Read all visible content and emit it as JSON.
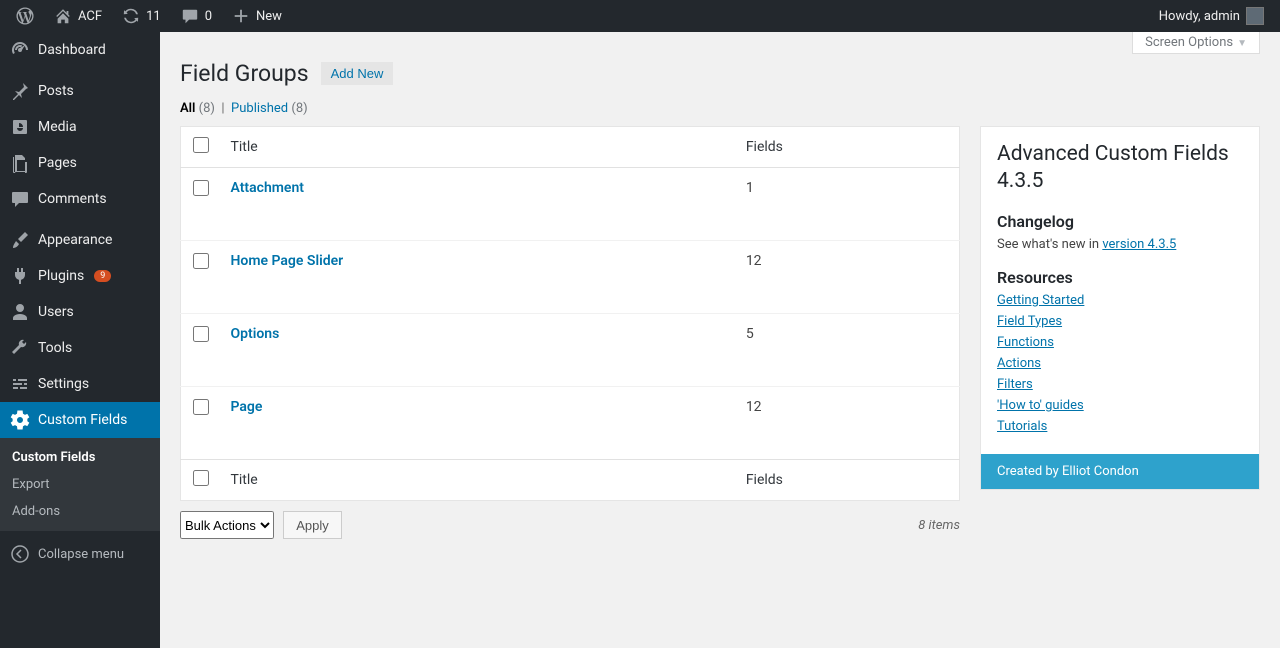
{
  "adminbar": {
    "site_name": "ACF",
    "updates_count": "11",
    "comments_count": "0",
    "new_label": "New",
    "howdy_prefix": "Howdy,",
    "user_name": "admin"
  },
  "sidebar": {
    "items": [
      {
        "label": "Dashboard",
        "icon": "dashboard"
      },
      {
        "label": "Posts",
        "icon": "pin"
      },
      {
        "label": "Media",
        "icon": "media"
      },
      {
        "label": "Pages",
        "icon": "pages"
      },
      {
        "label": "Comments",
        "icon": "comment"
      },
      {
        "label": "Appearance",
        "icon": "brush"
      },
      {
        "label": "Plugins",
        "icon": "plugin",
        "badge": "9"
      },
      {
        "label": "Users",
        "icon": "user"
      },
      {
        "label": "Tools",
        "icon": "wrench"
      },
      {
        "label": "Settings",
        "icon": "sliders"
      },
      {
        "label": "Custom Fields",
        "icon": "gear",
        "current": true
      }
    ],
    "submenu": [
      {
        "label": "Custom Fields",
        "current": true
      },
      {
        "label": "Export"
      },
      {
        "label": "Add-ons"
      }
    ],
    "collapse_label": "Collapse menu"
  },
  "screen_options_label": "Screen Options",
  "page": {
    "title": "Field Groups",
    "add_new_label": "Add New"
  },
  "filters": {
    "all_label": "All",
    "all_count": "(8)",
    "published_label": "Published",
    "published_count": "(8)"
  },
  "table": {
    "col_title": "Title",
    "col_fields": "Fields",
    "rows": [
      {
        "title": "Attachment",
        "fields": "1"
      },
      {
        "title": "Home Page Slider",
        "fields": "12"
      },
      {
        "title": "Options",
        "fields": "5"
      },
      {
        "title": "Page",
        "fields": "12"
      }
    ]
  },
  "bulk": {
    "select_label": "Bulk Actions",
    "apply_label": "Apply"
  },
  "items_count": "8 items",
  "panel": {
    "title": "Advanced Custom Fields 4.3.5",
    "changelog_heading": "Changelog",
    "changelog_prefix": "See what's new in ",
    "changelog_link": "version 4.3.5",
    "resources_heading": "Resources",
    "resources": [
      "Getting Started",
      "Field Types",
      "Functions",
      "Actions",
      "Filters",
      "'How to' guides",
      "Tutorials"
    ],
    "footer": "Created by Elliot Condon"
  }
}
